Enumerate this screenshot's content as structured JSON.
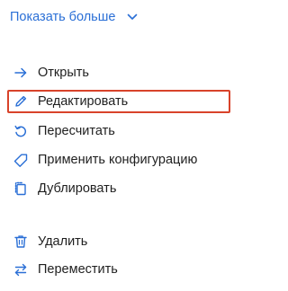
{
  "show_more": {
    "label": "Показать больше",
    "icon": "chevron-down-icon"
  },
  "menu": {
    "items": [
      {
        "label": "Открыть",
        "icon": "arrow-right-icon"
      },
      {
        "label": "Редактировать",
        "icon": "pencil-icon",
        "selected": true
      },
      {
        "label": "Пересчитать",
        "icon": "recalculate-icon"
      },
      {
        "label": "Применить конфигурацию",
        "icon": "tag-icon"
      },
      {
        "label": "Дублировать",
        "icon": "duplicate-icon"
      },
      {
        "label": "Удалить",
        "icon": "trash-icon"
      },
      {
        "label": "Переместить",
        "icon": "move-arrows-icon"
      }
    ]
  },
  "colors": {
    "accent": "#2a6fd6",
    "selection_border": "#d8432a",
    "text": "#1f1f1f"
  }
}
